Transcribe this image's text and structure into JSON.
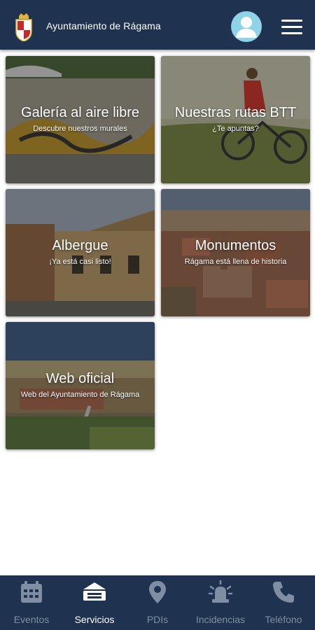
{
  "header": {
    "title": "Ayuntamiento de Rágama",
    "crest_icon": "coat-of-arms-icon",
    "avatar_icon": "user-avatar-icon",
    "menu_icon": "hamburger-menu-icon",
    "colors": {
      "bar": "#1f3350",
      "avatar": "#8fd3e8"
    }
  },
  "cards": [
    {
      "title": "Galería al aire libre",
      "subtitle": "Descubre nuestros murales"
    },
    {
      "title": "Nuestras rutas BTT",
      "subtitle": "¿Te apuntas?"
    },
    {
      "title": "Albergue",
      "subtitle": "¡Ya está casi listo!"
    },
    {
      "title": "Monumentos",
      "subtitle": "Rágama está llena de historia"
    },
    {
      "title": "Web oficial",
      "subtitle": "Web del Ayuntamiento de Rágama"
    }
  ],
  "bottom_nav": {
    "active": "Servicios",
    "items": [
      {
        "label": "Eventos",
        "icon": "calendar-icon"
      },
      {
        "label": "Servicios",
        "icon": "services-icon"
      },
      {
        "label": "PDIs",
        "icon": "map-pin-icon"
      },
      {
        "label": "Incidencias",
        "icon": "siren-icon"
      },
      {
        "label": "Teléfono",
        "icon": "phone-icon"
      }
    ]
  }
}
